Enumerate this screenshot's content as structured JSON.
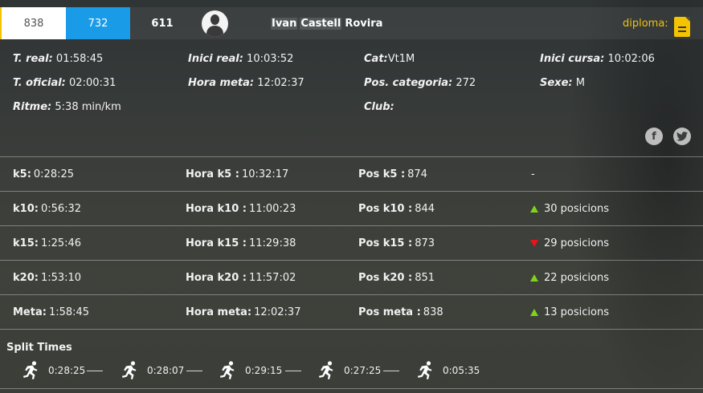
{
  "bib_tabs": {
    "pos_general": "838",
    "bib": "732",
    "pos_third": "611"
  },
  "runner": {
    "first_name": "Ivan",
    "last_name_1": "Castell",
    "last_name_2": "Rovira"
  },
  "diploma_label": "diploma:",
  "details": {
    "t_real_label": "T. real:",
    "t_real": "01:58:45",
    "t_oficial_label": "T. oficial:",
    "t_oficial": "02:00:31",
    "ritme_label": "Ritme:",
    "ritme": "5:38 min/km",
    "inici_real_label": "Inici real:",
    "inici_real": "10:03:52",
    "hora_meta_label": "Hora meta:",
    "hora_meta": "12:02:37",
    "cat_label": "Cat:",
    "cat": "Vt1M",
    "pos_categoria_label": "Pos. categoria:",
    "pos_categoria": "272",
    "club_label": "Club:",
    "club": "",
    "inici_cursa_label": "Inici cursa:",
    "inici_cursa": "10:02:06",
    "sexe_label": "Sexe:",
    "sexe": "M"
  },
  "social": {
    "facebook_glyph": "f",
    "twitter_glyph": "t"
  },
  "checkpoints": [
    {
      "split_label": "k5:",
      "split_time": "0:28:25",
      "hora_label": "Hora k5 :",
      "hora": "10:32:17",
      "pos_label": "Pos k5 :",
      "pos": "874",
      "trend": "none",
      "change": "-"
    },
    {
      "split_label": "k10:",
      "split_time": "0:56:32",
      "hora_label": "Hora k10 :",
      "hora": "11:00:23",
      "pos_label": "Pos k10 :",
      "pos": "844",
      "trend": "up",
      "change": "30 posicions"
    },
    {
      "split_label": "k15:",
      "split_time": "1:25:46",
      "hora_label": "Hora k15 :",
      "hora": "11:29:38",
      "pos_label": "Pos k15 :",
      "pos": "873",
      "trend": "down",
      "change": "29 posicions"
    },
    {
      "split_label": "k20:",
      "split_time": "1:53:10",
      "hora_label": "Hora k20 :",
      "hora": "11:57:02",
      "pos_label": "Pos k20 :",
      "pos": "851",
      "trend": "up",
      "change": "22 posicions"
    },
    {
      "split_label": "Meta:",
      "split_time": "1:58:45",
      "hora_label": "Hora meta:",
      "hora": "12:02:37",
      "pos_label": "Pos meta :",
      "pos": "838",
      "trend": "up",
      "change": "13 posicions"
    }
  ],
  "split_times": {
    "title": "Split Times",
    "items": [
      "0:28:25",
      "0:28:07",
      "0:29:15",
      "0:27:25",
      "0:05:35"
    ]
  },
  "colors": {
    "accent_yellow": "#f5c200",
    "bib_blue": "#1a9be8",
    "trend_up": "#7fd31c",
    "trend_down": "#e8141b"
  }
}
